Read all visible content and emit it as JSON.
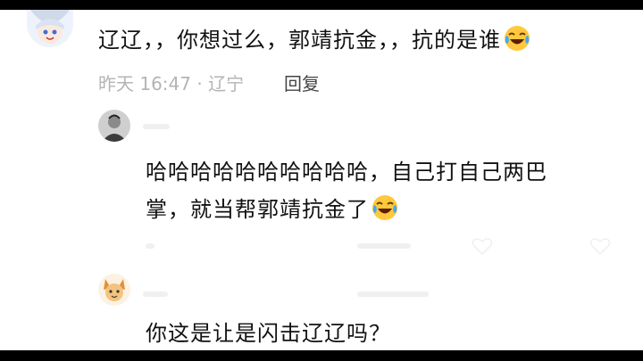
{
  "main_comment": {
    "text": "辽辽，，你想过么，郭靖抗金，，抗的是谁",
    "emoji": "laughing-tears-emoji",
    "meta": "昨天 16:47 · 辽宁",
    "reply_label": "回复"
  },
  "replies": [
    {
      "line1": "哈哈哈哈哈哈哈哈哈哈，自己打自己两巴",
      "line2": "掌，就当帮郭靖抗金了",
      "emoji": "laughing-tears-emoji"
    },
    {
      "text": "你这是让是闪击辽辽吗？"
    }
  ],
  "colors": {
    "meta_gray": "#b4b4b4",
    "reply_text": "#444444",
    "emoji_yellow": "#ffc83d",
    "tear_blue": "#3fa9f5"
  }
}
